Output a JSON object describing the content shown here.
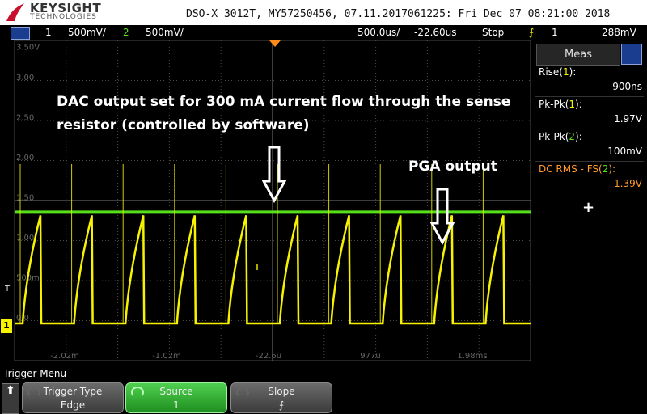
{
  "logo": {
    "brand": "KEYSIGHT",
    "sub": "TECHNOLOGIES",
    "brand_color": "#c8102e"
  },
  "header": {
    "info": "DSO-X 3012T, MY57250456, 07.11.2017061225: Fri Dec 07 08:21:00 2018"
  },
  "statusbar": {
    "ch1_num": "1",
    "ch1_scale": "500mV/",
    "ch2_num": "2",
    "ch2_scale": "500mV/",
    "timebase": "500.0us/",
    "delay": "-22.60us",
    "run_state": "Stop",
    "trigger_source": "1",
    "trigger_level": "288mV",
    "icon": "trigger-edge-icon"
  },
  "plot": {
    "y_labels": [
      "3.50V",
      "3.00",
      "2.50",
      "2.00",
      "1.50",
      "1.00",
      "500m",
      "0.0"
    ],
    "x_labels": [
      "-2.02m",
      "-1.02m",
      "-22.6u",
      "977u",
      "1.98ms"
    ],
    "ch1_ground_marker": "1",
    "trigger_marker": "T",
    "ch2_level_v": 1.37,
    "ch1_baseline_v": -0.02,
    "ch1_peak_v": 1.97,
    "colors": {
      "ch1": "#f6f200",
      "ch2": "#55e01a",
      "grid": "#4a4a4a"
    }
  },
  "annotations": {
    "dac_line1": "DAC output set for 300 mA current flow through the sense",
    "dac_line2": "resistor (controlled by software)",
    "pga": "PGA output"
  },
  "meas": {
    "title": "Meas",
    "items": [
      {
        "label_pre": "Rise(",
        "ch": "1",
        "label_post": "):",
        "value": "900ns",
        "color": "#ffffff"
      },
      {
        "label_pre": "Pk-Pk(",
        "ch": "1",
        "label_post": "):",
        "value": "1.97V",
        "color": "#ffffff"
      },
      {
        "label_pre": "Pk-Pk(",
        "ch": "2",
        "label_post": "):",
        "value": "100mV",
        "color": "#ffffff"
      },
      {
        "label_pre": "DC RMS - FS(",
        "ch": "2",
        "label_post": "):",
        "value": "1.39V",
        "color": "#ff9a2e"
      }
    ],
    "add": "+"
  },
  "softkeys": {
    "menu_title": "Trigger Menu",
    "back": "⬆",
    "trigger_type": {
      "label": "Trigger Type",
      "value": "Edge"
    },
    "source": {
      "label": "Source",
      "value": "1"
    },
    "slope": {
      "label": "Slope",
      "value": "⨍"
    }
  }
}
